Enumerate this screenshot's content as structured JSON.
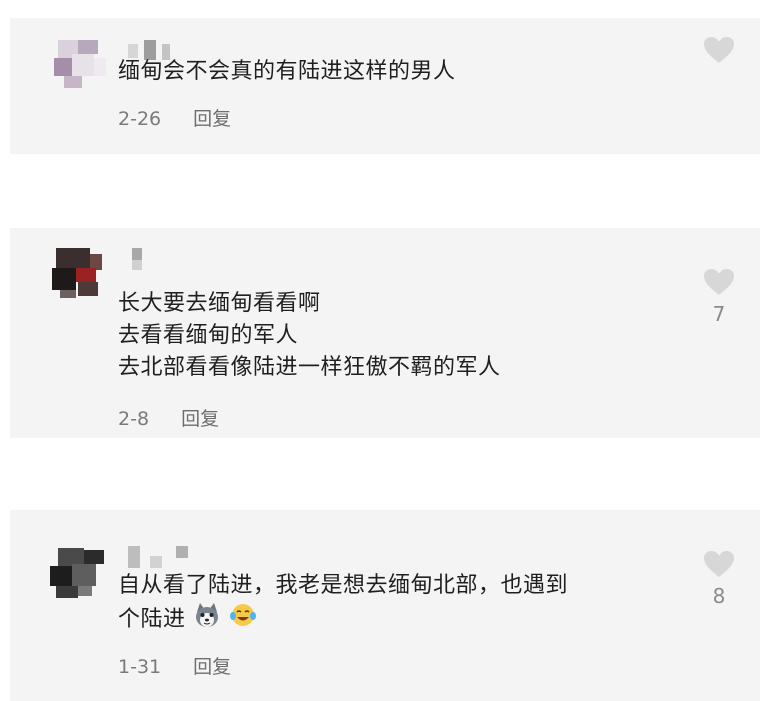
{
  "comments": [
    {
      "text_lines": [
        "缅甸会不会真的有陆进这样的男人"
      ],
      "date": "2-26",
      "reply_label": "回复",
      "like_count": ""
    },
    {
      "text_lines": [
        "长大要去缅甸看看啊",
        "去看看缅甸的军人",
        "去北部看看像陆进一样狂傲不羁的军人"
      ],
      "date": "2-8",
      "reply_label": "回复",
      "like_count": "7"
    },
    {
      "text_lines": [
        "自从看了陆进，我老是想去缅甸北部，也遇到",
        "个陆进"
      ],
      "date": "1-31",
      "reply_label": "回复",
      "like_count": "8",
      "emojis": [
        "husky-dog-emoji",
        "laughing-tears-emoji"
      ]
    }
  ],
  "colors": {
    "card_background": "#f4f4f4",
    "like_icon": "#d7d7d7",
    "meta_text": "#7a7a7a"
  }
}
